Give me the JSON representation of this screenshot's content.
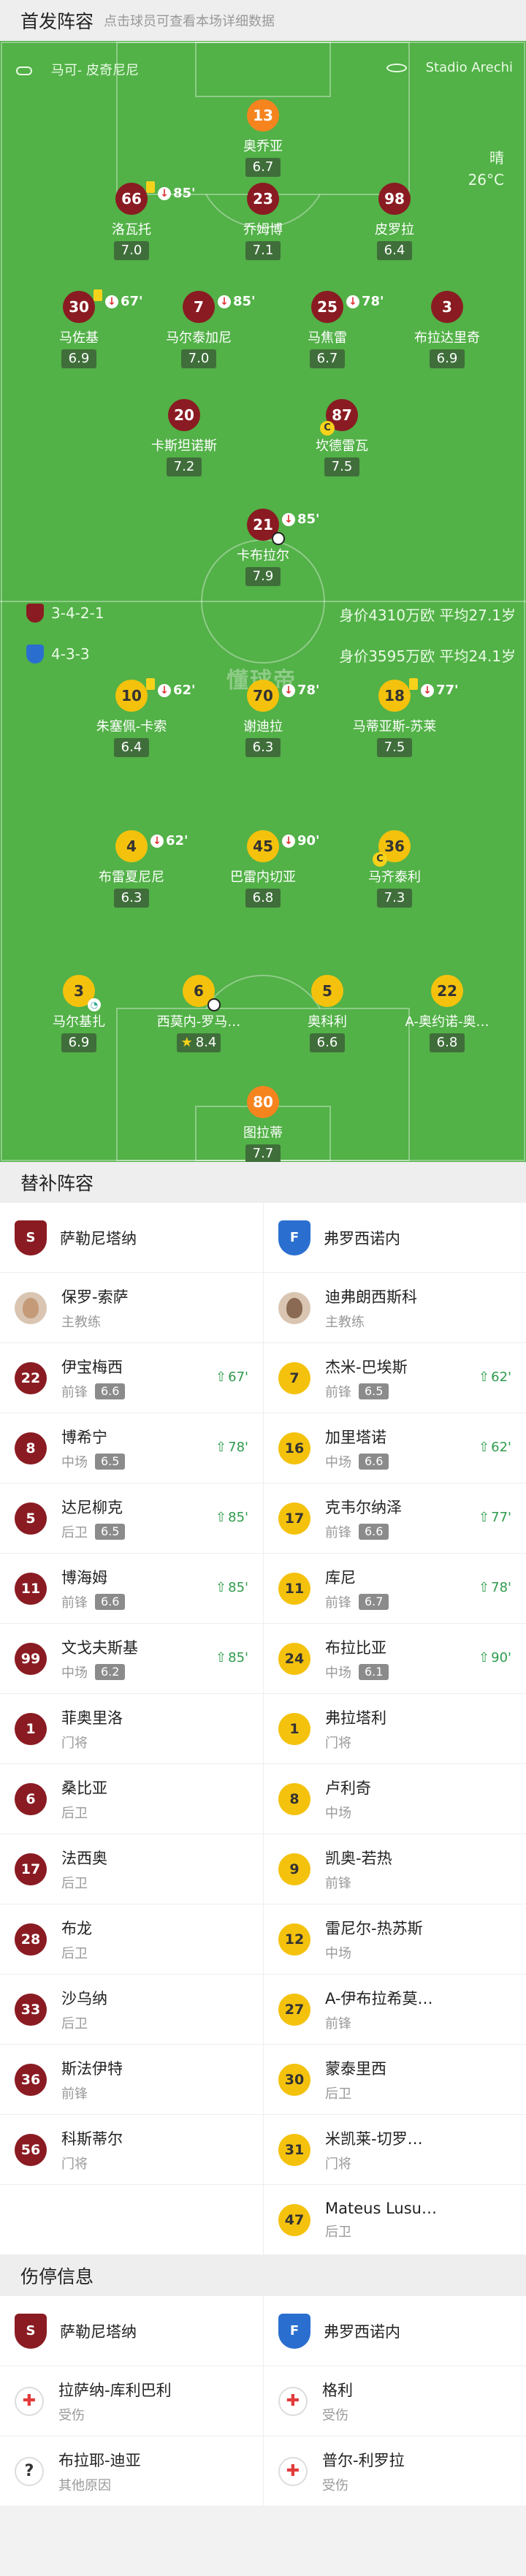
{
  "lineup_header": {
    "title": "首发阵容",
    "hint": "点击球员可查看本场详细数据"
  },
  "pitch": {
    "home_coach": "马可- 皮奇尼尼",
    "stadium": "Stadio Arechi",
    "weather": "晴",
    "temperature": "26°C",
    "watermark": "懂球帝",
    "home_formation": "3-4-2-1",
    "home_stats": "身价4310万欧  平均27.1岁",
    "away_formation": "4-3-3",
    "away_stats": "身价3595万欧  平均24.1岁"
  },
  "home_players": [
    {
      "no": "13",
      "name": "奥乔亚",
      "rating": "6.7"
    },
    {
      "no": "66",
      "name": "洛瓦托",
      "rating": "7.0",
      "sub": "85'",
      "yc": true
    },
    {
      "no": "23",
      "name": "乔姆博",
      "rating": "7.1"
    },
    {
      "no": "98",
      "name": "皮罗拉",
      "rating": "6.4"
    },
    {
      "no": "30",
      "name": "马佐基",
      "rating": "6.9",
      "sub": "67'",
      "yc": true
    },
    {
      "no": "7",
      "name": "马尔泰加尼",
      "rating": "7.0",
      "sub": "85'"
    },
    {
      "no": "25",
      "name": "马焦雷",
      "rating": "6.7",
      "sub": "78'"
    },
    {
      "no": "3",
      "name": "布拉达里奇",
      "rating": "6.9"
    },
    {
      "no": "20",
      "name": "卡斯坦诺斯",
      "rating": "7.2"
    },
    {
      "no": "87",
      "name": "坎德雷瓦",
      "rating": "7.5"
    },
    {
      "no": "21",
      "name": "卡布拉尔",
      "rating": "7.9",
      "sub": "85'"
    }
  ],
  "away_players": [
    {
      "no": "10",
      "name": "朱塞佩-卡索",
      "rating": "6.4",
      "sub": "62'",
      "yc": true
    },
    {
      "no": "70",
      "name": "谢迪拉",
      "rating": "6.3",
      "sub": "78'"
    },
    {
      "no": "18",
      "name": "马蒂亚斯-苏莱",
      "rating": "7.5",
      "sub": "77'",
      "yc": true
    },
    {
      "no": "4",
      "name": "布雷夏尼尼",
      "rating": "6.3",
      "sub": "62'"
    },
    {
      "no": "45",
      "name": "巴雷内切亚",
      "rating": "6.8",
      "sub": "90'"
    },
    {
      "no": "36",
      "name": "马齐泰利",
      "rating": "7.3"
    },
    {
      "no": "3",
      "name": "马尔基扎",
      "rating": "6.9"
    },
    {
      "no": "6",
      "name": "西莫内-罗马…",
      "rating": "8.4"
    },
    {
      "no": "5",
      "name": "奥科利",
      "rating": "6.6"
    },
    {
      "no": "22",
      "name": "A-奥约诺-奥…",
      "rating": "6.8"
    },
    {
      "no": "80",
      "name": "图拉蒂",
      "rating": "7.7"
    }
  ],
  "subs_header": {
    "title": "替补阵容"
  },
  "teams": {
    "home": "萨勒尼塔纳",
    "away": "弗罗西诺内"
  },
  "coaches": {
    "home": {
      "name": "保罗-索萨",
      "role": "主教练"
    },
    "away": {
      "name": "迪弗朗西斯科",
      "role": "主教练"
    }
  },
  "subs": [
    [
      {
        "no": "22",
        "name": "伊宝梅西",
        "pos": "前锋",
        "rating": "6.6",
        "in": "67'"
      },
      {
        "no": "7",
        "name": "杰米-巴埃斯",
        "pos": "前锋",
        "rating": "6.5",
        "in": "62'"
      }
    ],
    [
      {
        "no": "8",
        "name": "博希宁",
        "pos": "中场",
        "rating": "6.5",
        "in": "78'"
      },
      {
        "no": "16",
        "name": "加里塔诺",
        "pos": "中场",
        "rating": "6.6",
        "in": "62'"
      }
    ],
    [
      {
        "no": "5",
        "name": "达尼柳克",
        "pos": "后卫",
        "rating": "6.5",
        "in": "85'"
      },
      {
        "no": "17",
        "name": "克韦尔纳泽",
        "pos": "前锋",
        "rating": "6.6",
        "in": "77'"
      }
    ],
    [
      {
        "no": "11",
        "name": "博海姆",
        "pos": "前锋",
        "rating": "6.6",
        "in": "85'"
      },
      {
        "no": "11",
        "name": "库尼",
        "pos": "前锋",
        "rating": "6.7",
        "in": "78'"
      }
    ],
    [
      {
        "no": "99",
        "name": "文戈夫斯基",
        "pos": "中场",
        "rating": "6.2",
        "in": "85'"
      },
      {
        "no": "24",
        "name": "布拉比亚",
        "pos": "中场",
        "rating": "6.1",
        "in": "90'"
      }
    ],
    [
      {
        "no": "1",
        "name": "菲奥里洛",
        "pos": "门将"
      },
      {
        "no": "1",
        "name": "弗拉塔利",
        "pos": "门将"
      }
    ],
    [
      {
        "no": "6",
        "name": "桑比亚",
        "pos": "后卫"
      },
      {
        "no": "8",
        "name": "卢利奇",
        "pos": "中场"
      }
    ],
    [
      {
        "no": "17",
        "name": "法西奥",
        "pos": "后卫"
      },
      {
        "no": "9",
        "name": "凯奥-若热",
        "pos": "前锋"
      }
    ],
    [
      {
        "no": "28",
        "name": "布龙",
        "pos": "后卫"
      },
      {
        "no": "12",
        "name": "雷尼尔-热苏斯",
        "pos": "中场"
      }
    ],
    [
      {
        "no": "33",
        "name": "沙乌纳",
        "pos": "后卫"
      },
      {
        "no": "27",
        "name": "A-伊布拉希莫…",
        "pos": "前锋"
      }
    ],
    [
      {
        "no": "36",
        "name": "斯法伊特",
        "pos": "前锋"
      },
      {
        "no": "30",
        "name": "蒙泰里西",
        "pos": "后卫"
      }
    ],
    [
      {
        "no": "56",
        "name": "科斯蒂尔",
        "pos": "门将"
      },
      {
        "no": "31",
        "name": "米凯莱-切罗…",
        "pos": "门将"
      }
    ],
    [
      null,
      {
        "no": "47",
        "name": "Mateus Lusu…",
        "pos": "后卫"
      }
    ]
  ],
  "injury_header": {
    "title": "伤停信息"
  },
  "injuries": [
    [
      {
        "name": "拉萨纳-库利巴利",
        "reason": "受伤",
        "icon": "medical-cross-icon"
      },
      {
        "name": "格利",
        "reason": "受伤",
        "icon": "medical-cross-icon"
      }
    ],
    [
      {
        "name": "布拉耶-迪亚",
        "reason": "其他原因",
        "icon": "question-icon"
      },
      {
        "name": "普尔-利罗拉",
        "reason": "受伤",
        "icon": "medical-cross-icon"
      }
    ]
  ],
  "colors": {
    "pitch": "#52b147",
    "home": "#8a1b22",
    "away": "#f4c20d",
    "gk": "#f5841f",
    "sub_in": "#2e9b4b"
  }
}
